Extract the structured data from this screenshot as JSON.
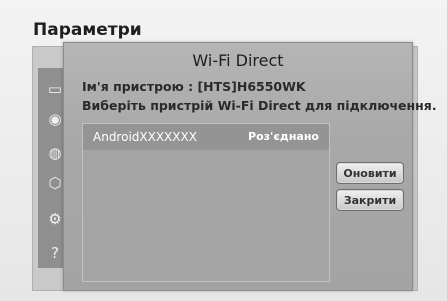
{
  "screen": {
    "title": "Параметри"
  },
  "sidebar": {
    "icons": [
      "picture-icon",
      "sound-icon",
      "network-icon",
      "smart-hub-icon",
      "system-icon",
      "support-icon"
    ]
  },
  "dialog": {
    "title": "Wi-Fi Direct",
    "device_name": "Ім'я пристрою : [HTS]H6550WK",
    "prompt": "Виберіть пристрій Wi-Fi Direct для підключення.",
    "devices": [
      {
        "name": "AndroidXXXXXXX",
        "status": "Роз'єднано"
      }
    ],
    "buttons": {
      "refresh": "Оновити",
      "close": "Закрити"
    }
  }
}
